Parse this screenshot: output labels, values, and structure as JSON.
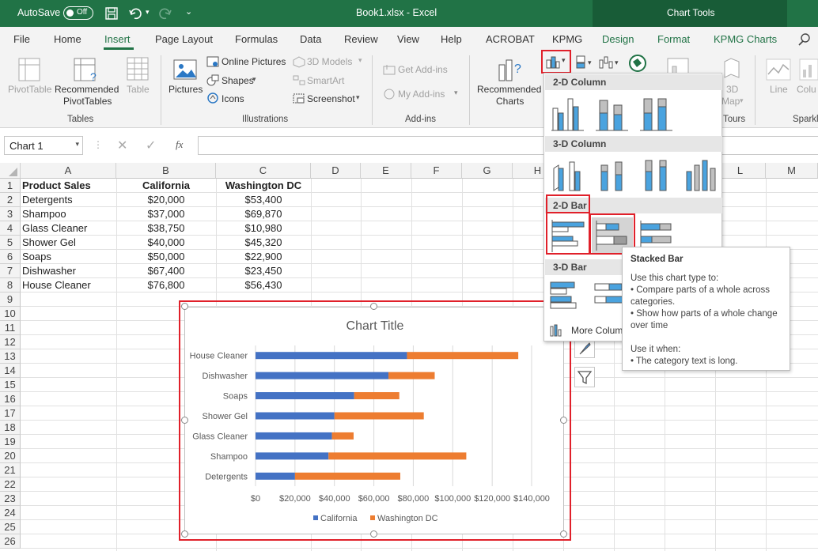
{
  "titlebar": {
    "autosave": "AutoSave",
    "toggle": "Off",
    "file": "Book1.xlsx  -  Excel",
    "context": "Chart Tools"
  },
  "tabs": [
    "File",
    "Home",
    "Insert",
    "Page Layout",
    "Formulas",
    "Data",
    "Review",
    "View",
    "Help",
    "ACROBAT",
    "KPMG",
    "Design",
    "Format",
    "KPMG Charts"
  ],
  "ribbon": {
    "pivot": "PivotTable",
    "rec_pivot1": "Recommended",
    "rec_pivot2": "PivotTables",
    "table": "Table",
    "pictures": "Pictures",
    "online_pictures": "Online Pictures",
    "shapes": "Shapes",
    "icons": "Icons",
    "models": "3D Models",
    "smartart": "SmartArt",
    "screenshot": "Screenshot",
    "get_addins": "Get Add-ins",
    "my_addins": "My Add-ins",
    "rec_charts1": "Recommended",
    "rec_charts2": "Charts",
    "map3d1": "3D",
    "map3d2": "Map",
    "line": "Line",
    "colu": "Colu",
    "groups": {
      "tables": "Tables",
      "illustrations": "Illustrations",
      "addins": "Add-ins",
      "tours": "Tours",
      "sparkl": "Sparkl"
    }
  },
  "formula": {
    "namebox": "Chart 1",
    "fx": "fx"
  },
  "columns": [
    "A",
    "B",
    "C",
    "D",
    "E",
    "F",
    "G",
    "H",
    "I",
    "J",
    "K",
    "L",
    "M"
  ],
  "rows": [
    "1",
    "2",
    "3",
    "4",
    "5",
    "6",
    "7",
    "8",
    "9",
    "10",
    "11",
    "12",
    "13",
    "14",
    "15",
    "16",
    "17",
    "18",
    "19",
    "20",
    "21",
    "22",
    "23",
    "24",
    "25",
    "26"
  ],
  "sheet": {
    "headers": [
      "Product Sales",
      "California",
      "Washington DC"
    ],
    "data": [
      [
        "Detergents",
        "$20,000",
        "$53,400"
      ],
      [
        "Shampoo",
        "$37,000",
        "$69,870"
      ],
      [
        "Glass Cleaner",
        "$38,750",
        "$10,980"
      ],
      [
        "Shower Gel",
        "$40,000",
        "$45,320"
      ],
      [
        "Soaps",
        "$50,000",
        "$22,900"
      ],
      [
        "Dishwasher",
        "$67,400",
        "$23,450"
      ],
      [
        "House Cleaner",
        "$76,800",
        "$56,430"
      ]
    ]
  },
  "dropdown": {
    "col2d": "2-D Column",
    "col3d": "3-D Column",
    "bar2d": "2-D Bar",
    "bar3d": "3-D Bar",
    "more": "More Colum"
  },
  "tooltip": {
    "title": "Stacked Bar",
    "use1": "Use this chart type to:",
    "b1": "• Compare parts of a whole across categories.",
    "b2": "• Show how parts of a whole change over time",
    "use2": "Use it when:",
    "b3": "• The category text is long."
  },
  "chart_data": {
    "type": "bar",
    "orientation": "horizontal",
    "stacked": true,
    "title": "Chart Title",
    "categories": [
      "Detergents",
      "Shampoo",
      "Glass Cleaner",
      "Shower Gel",
      "Soaps",
      "Dishwasher",
      "House Cleaner"
    ],
    "series": [
      {
        "name": "California",
        "color": "#4472c4",
        "values": [
          20000,
          37000,
          38750,
          40000,
          50000,
          67400,
          76800
        ]
      },
      {
        "name": "Washington DC",
        "color": "#ed7d31",
        "values": [
          53400,
          69870,
          10980,
          45320,
          22900,
          23450,
          56430
        ]
      }
    ],
    "xlim": [
      0,
      140000
    ],
    "xticks": [
      "$0",
      "$20,000",
      "$40,000",
      "$60,000",
      "$80,000",
      "$100,000",
      "$120,000",
      "$140,000"
    ],
    "grid": true,
    "legend": "bottom"
  }
}
